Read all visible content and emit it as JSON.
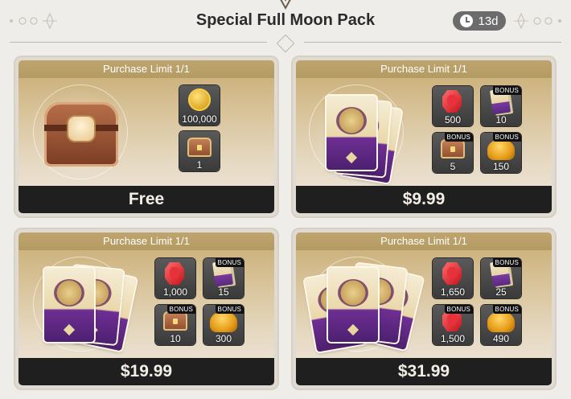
{
  "header": {
    "title": "Special Full Moon Pack",
    "timer": "13d"
  },
  "packs": [
    {
      "limit": "Purchase Limit 1/1",
      "price": "Free",
      "hero": "chest",
      "items": [
        {
          "icon": "gold-coin-icon",
          "qty": "100,000",
          "bonus": ""
        },
        {
          "icon": "treasure-chest-icon",
          "qty": "1",
          "bonus": ""
        }
      ]
    },
    {
      "limit": "Purchase Limit 1/1",
      "price": "$9.99",
      "hero": "cards",
      "items": [
        {
          "icon": "ruby-gem-icon",
          "qty": "500",
          "bonus": ""
        },
        {
          "icon": "card-pack-icon",
          "qty": "10",
          "bonus": "BONUS"
        },
        {
          "icon": "treasure-chest-icon",
          "qty": "5",
          "bonus": "BONUS"
        },
        {
          "icon": "gold-pile-icon",
          "qty": "150",
          "bonus": "BONUS"
        }
      ]
    },
    {
      "limit": "Purchase Limit 1/1",
      "price": "$19.99",
      "hero": "cards",
      "items": [
        {
          "icon": "ruby-gem-icon",
          "qty": "1,000",
          "bonus": ""
        },
        {
          "icon": "card-pack-icon",
          "qty": "15",
          "bonus": "BONUS"
        },
        {
          "icon": "treasure-chest-icon",
          "qty": "10",
          "bonus": "BONUS"
        },
        {
          "icon": "gold-pile-icon",
          "qty": "300",
          "bonus": "BONUS"
        }
      ]
    },
    {
      "limit": "Purchase Limit 1/1",
      "price": "$31.99",
      "hero": "cards",
      "items": [
        {
          "icon": "ruby-gem-icon",
          "qty": "1,650",
          "bonus": ""
        },
        {
          "icon": "card-pack-icon",
          "qty": "25",
          "bonus": "BONUS"
        },
        {
          "icon": "ruby-gem-icon",
          "qty": "1,500",
          "bonus": "BONUS"
        },
        {
          "icon": "gold-pile-icon",
          "qty": "490",
          "bonus": "BONUS"
        }
      ]
    }
  ]
}
